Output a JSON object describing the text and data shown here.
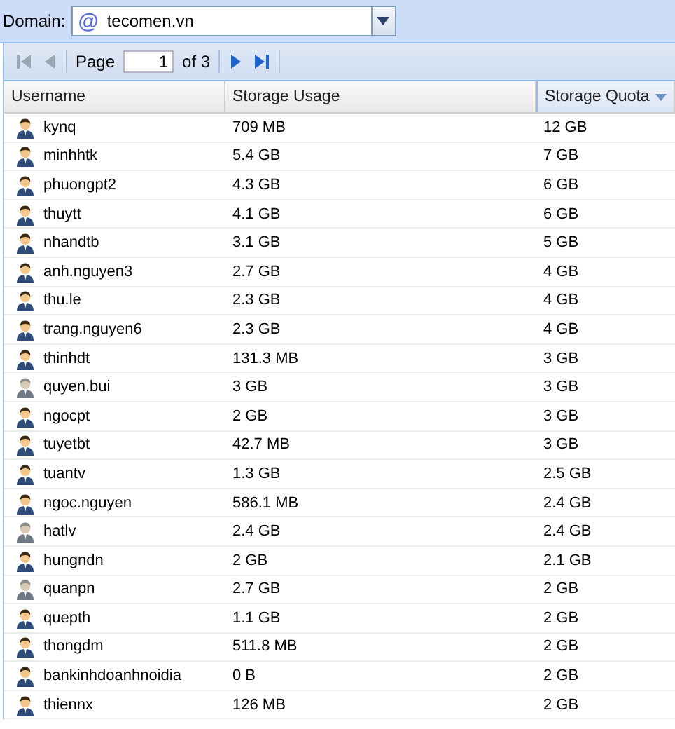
{
  "domain": {
    "label": "Domain:",
    "value": "tecomen.vn",
    "icon": "@"
  },
  "pager": {
    "label": "Page",
    "value": "1",
    "of": "of 3"
  },
  "columns": [
    {
      "label": "Username",
      "sorted": false
    },
    {
      "label": "Storage Usage",
      "sorted": false
    },
    {
      "label": "Storage Quota",
      "sorted": true
    }
  ],
  "rows": [
    {
      "username": "kynq",
      "usage": "709 MB",
      "quota": "12 GB",
      "inactive": false
    },
    {
      "username": "minhhtk",
      "usage": "5.4 GB",
      "quota": "7 GB",
      "inactive": false
    },
    {
      "username": "phuongpt2",
      "usage": "4.3 GB",
      "quota": "6 GB",
      "inactive": false
    },
    {
      "username": "thuytt",
      "usage": "4.1 GB",
      "quota": "6 GB",
      "inactive": false
    },
    {
      "username": "nhandtb",
      "usage": "3.1 GB",
      "quota": "5 GB",
      "inactive": false
    },
    {
      "username": "anh.nguyen3",
      "usage": "2.7 GB",
      "quota": "4 GB",
      "inactive": false
    },
    {
      "username": "thu.le",
      "usage": "2.3 GB",
      "quota": "4 GB",
      "inactive": false
    },
    {
      "username": "trang.nguyen6",
      "usage": "2.3 GB",
      "quota": "4 GB",
      "inactive": false
    },
    {
      "username": "thinhdt",
      "usage": "131.3 MB",
      "quota": "3 GB",
      "inactive": false
    },
    {
      "username": "quyen.bui",
      "usage": "3 GB",
      "quota": "3 GB",
      "inactive": true
    },
    {
      "username": "ngocpt",
      "usage": "2 GB",
      "quota": "3 GB",
      "inactive": false
    },
    {
      "username": "tuyetbt",
      "usage": "42.7 MB",
      "quota": "3 GB",
      "inactive": false
    },
    {
      "username": "tuantv",
      "usage": "1.3 GB",
      "quota": "2.5 GB",
      "inactive": false
    },
    {
      "username": "ngoc.nguyen",
      "usage": "586.1 MB",
      "quota": "2.4 GB",
      "inactive": false
    },
    {
      "username": "hatlv",
      "usage": "2.4 GB",
      "quota": "2.4 GB",
      "inactive": true
    },
    {
      "username": "hungndn",
      "usage": "2 GB",
      "quota": "2.1 GB",
      "inactive": false
    },
    {
      "username": "quanpn",
      "usage": "2.7 GB",
      "quota": "2 GB",
      "inactive": true
    },
    {
      "username": "quepth",
      "usage": "1.1 GB",
      "quota": "2 GB",
      "inactive": false
    },
    {
      "username": "thongdm",
      "usage": "511.8 MB",
      "quota": "2 GB",
      "inactive": false
    },
    {
      "username": "bankinhdoanhnoidia",
      "usage": "0 B",
      "quota": "2 GB",
      "inactive": false
    },
    {
      "username": "thiennx",
      "usage": "126 MB",
      "quota": "2 GB",
      "inactive": false
    }
  ]
}
